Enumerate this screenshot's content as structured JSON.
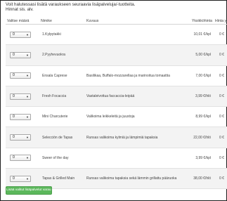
{
  "intro": {
    "line1": "Voit halutessasi lisätä varaukseen seuraavia lisäpalveluja/-tuotteita.",
    "line2": "Hinnat sis. alv."
  },
  "table": {
    "headers": {
      "qty": "Valitse määrä",
      "name": "Nimike",
      "desc": "Kuvaus",
      "price": "Yksikköhinta",
      "total": "Hinta yht."
    },
    "rows": [
      {
        "qty": "0",
        "name": "1.Kylpytakki",
        "desc": "",
        "price": "10,01 €/kpl",
        "total": "0 €"
      },
      {
        "qty": "0",
        "name": "2.Pyyhevuokra",
        "desc": "",
        "price": "5,00 €/kpl",
        "total": "0 €"
      },
      {
        "qty": "0",
        "name": "Ensala Caprese",
        "desc": "Basilikaa, Buffalo-mozzarellaa ja marinoitua tomaattia",
        "price": "7,00 €/kpl",
        "total": "0 €"
      },
      {
        "qty": "0",
        "name": "Fresh Focaccia",
        "desc": "Vastaleivottua faccaccia-leipää",
        "price": "3,99 €/hlö",
        "total": "0 €"
      },
      {
        "qty": "0",
        "name": "Mini Charcuterie",
        "desc": "Valikoima leikkeleitä ja juustoja",
        "price": "8,99 €/kpl",
        "total": "0 €"
      },
      {
        "qty": "0",
        "name": "Selección de Tapas",
        "desc": "Runsas valikoima kylmiä ja lämpimiä tapaksia",
        "price": "22,00 €/hlö",
        "total": "0 €"
      },
      {
        "qty": "0",
        "name": "Sweer of the day",
        "desc": "",
        "price": "3,99 €/kpl",
        "total": "0 €"
      },
      {
        "qty": "0",
        "name": "Tapas & Grilled Main",
        "desc": "Runsas valikoima tapaksia sekä lämmin grillattu pääruoka",
        "price": "38,00 €/hlö",
        "total": "0 €"
      }
    ]
  },
  "submit_label": "Lisää valitut lisäpalvelut varaukseen",
  "colors": {
    "submit": "#5cb85c",
    "row_alt": "#f3f3f3"
  }
}
